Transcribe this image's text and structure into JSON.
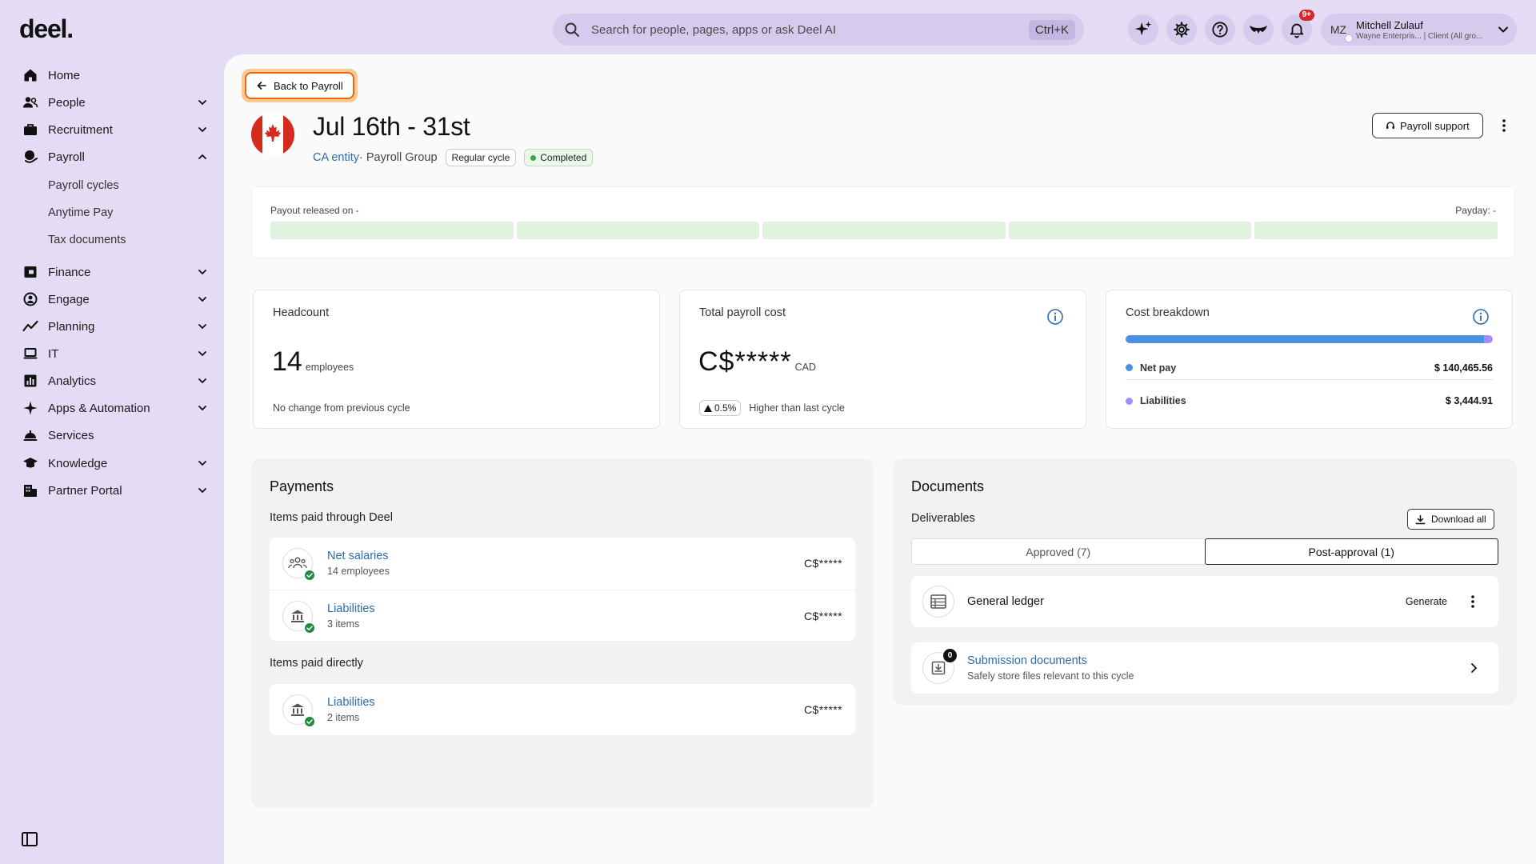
{
  "brand": {
    "logo": "deel."
  },
  "search": {
    "placeholder": "Search for people, pages, apps or ask Deel AI",
    "shortcut": "Ctrl+K"
  },
  "header": {
    "notifications_badge": "9+",
    "user": {
      "initials": "MZ",
      "name": "Mitchell Zulauf",
      "subtitle": "Wayne Enterpris... | Client (All gro..."
    }
  },
  "sidebar": {
    "items": [
      {
        "label": "Home",
        "icon": "home-icon"
      },
      {
        "label": "People",
        "icon": "people-icon"
      },
      {
        "label": "Recruitment",
        "icon": "briefcase-icon"
      },
      {
        "label": "Payroll",
        "icon": "payroll-icon",
        "expanded": true
      },
      {
        "label": "Finance",
        "icon": "wallet-icon"
      },
      {
        "label": "Engage",
        "icon": "engage-icon"
      },
      {
        "label": "Planning",
        "icon": "trend-icon"
      },
      {
        "label": "IT",
        "icon": "laptop-icon"
      },
      {
        "label": "Analytics",
        "icon": "analytics-icon"
      },
      {
        "label": "Apps & Automation",
        "icon": "apps-icon"
      },
      {
        "label": "Services",
        "icon": "services-icon"
      },
      {
        "label": "Knowledge",
        "icon": "graduation-icon"
      },
      {
        "label": "Partner Portal",
        "icon": "building-icon"
      }
    ],
    "payroll_sub": [
      "Payroll cycles",
      "Anytime Pay",
      "Tax documents"
    ]
  },
  "page": {
    "back_label": "Back to Payroll",
    "title": "Jul 16th - 31st",
    "entity": "CA entity",
    "group": " · Payroll Group",
    "cycle_pill": "Regular cycle",
    "status_pill": "Completed",
    "support_label": "Payroll support"
  },
  "timeline": {
    "left": "Payout released on -",
    "right": "Payday: -"
  },
  "stats": {
    "headcount": {
      "label": "Headcount",
      "value": "14",
      "unit": "employees",
      "note": "No change from previous cycle"
    },
    "total_cost": {
      "label": "Total payroll cost",
      "value": "C$*****",
      "unit": "CAD",
      "trend": "0.5%",
      "note": "Higher than last cycle"
    },
    "breakdown": {
      "label": "Cost breakdown",
      "net_share": 0.976,
      "items": [
        {
          "name": "Net pay",
          "value": "$ 140,465.56",
          "color": "#4a90e2"
        },
        {
          "name": "Liabilities",
          "value": "$ 3,444.91",
          "color": "#a78bfa"
        }
      ]
    }
  },
  "payments": {
    "title": "Payments",
    "through_deel_label": "Items paid through Deel",
    "through_deel": [
      {
        "name": "Net salaries",
        "desc": "14 employees",
        "amount": "C$*****"
      },
      {
        "name": "Liabilities",
        "desc": "3 items",
        "amount": "C$*****"
      }
    ],
    "direct_label": "Items paid directly",
    "direct": [
      {
        "name": "Liabilities",
        "desc": "2 items",
        "amount": "C$*****"
      }
    ]
  },
  "documents": {
    "title": "Documents",
    "deliverables_label": "Deliverables",
    "download_label": "Download all",
    "tabs": [
      "Approved (7)",
      "Post-approval (1)"
    ],
    "ledger": {
      "name": "General ledger",
      "action": "Generate"
    },
    "submission": {
      "name": "Submission documents",
      "desc": "Safely store files relevant to this cycle",
      "count": "0"
    }
  }
}
